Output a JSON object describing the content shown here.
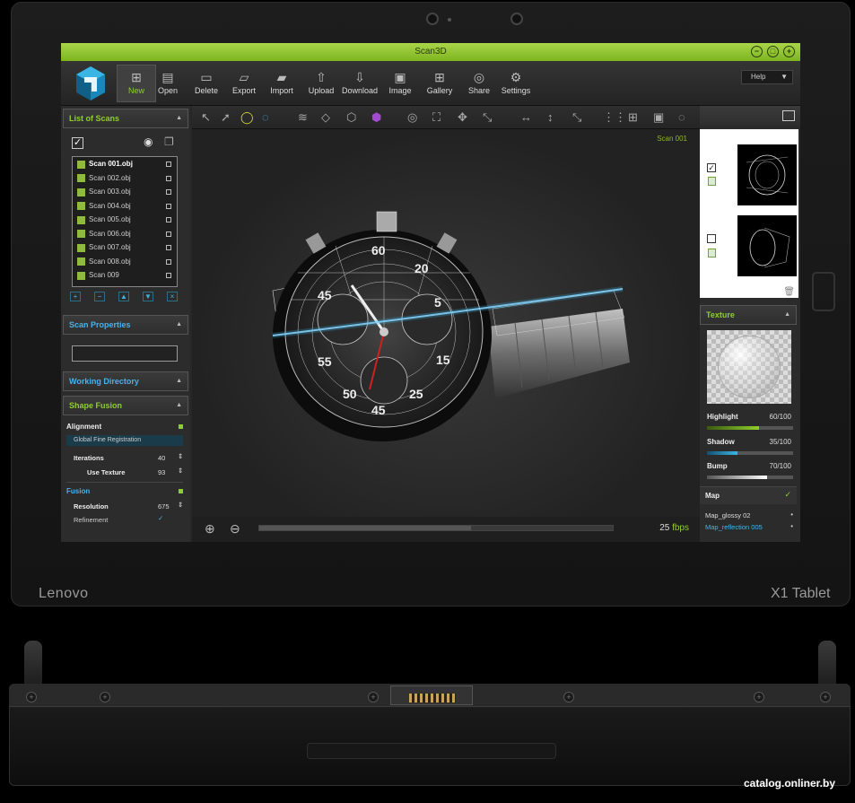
{
  "device": {
    "brand_left": "Lenovo",
    "brand_right": "X1 Tablet",
    "watermark": "catalog.onliner.by"
  },
  "app": {
    "title": "Scan3D",
    "accent": "#8fcf2c",
    "window_controls": [
      "minimize",
      "restore",
      "close"
    ]
  },
  "toolbar": {
    "buttons": [
      {
        "label": "New",
        "icon": "new-file-icon",
        "active": true
      },
      {
        "label": "Open",
        "icon": "open-file-icon"
      },
      {
        "label": "Delete",
        "icon": "delete-file-icon"
      },
      {
        "label": "Export",
        "icon": "folder-icon"
      },
      {
        "label": "Import",
        "icon": "import-folder-icon"
      },
      {
        "label": "Upload",
        "icon": "upload-icon"
      },
      {
        "label": "Download",
        "icon": "download-icon"
      },
      {
        "label": "Image",
        "icon": "image-icon"
      },
      {
        "label": "Gallery",
        "icon": "gallery-grid-icon"
      },
      {
        "label": "Share",
        "icon": "globe-icon"
      },
      {
        "label": "Settings",
        "icon": "gear-icon"
      }
    ],
    "help": "Help"
  },
  "left_panel": {
    "list_header": "List of Scans",
    "scans": [
      "Scan 001.obj",
      "Scan 002.obj",
      "Scan 003.obj",
      "Scan 004.obj",
      "Scan 005.obj",
      "Scan 006.obj",
      "Scan 007.obj",
      "Scan 008.obj",
      "Scan 009"
    ],
    "list_buttons": [
      "+",
      "−",
      "▲",
      "▼",
      "×"
    ],
    "scan_properties": "Scan Properties",
    "working_directory": "Working Directory",
    "shape_fusion": "Shape Fusion",
    "alignment": "Alignment",
    "registration": "Global Fine Registration",
    "iterations_label": "Iterations",
    "iterations_value": "40",
    "use_texture_label": "Use Texture",
    "use_texture_value": "93",
    "fusion": "Fusion",
    "resolution_label": "Resolution",
    "resolution_value": "675",
    "refinement_label": "Refinement"
  },
  "viewport": {
    "scan_label": "Scan 001",
    "fps_value": "25",
    "fps_unit": "fbps",
    "progress": 0.6
  },
  "right_panel": {
    "texture": "Texture",
    "highlight_label": "Highlight",
    "highlight_value": "60/100",
    "highlight": 0.6,
    "shadow_label": "Shadow",
    "shadow_value": "35/100",
    "shadow": 0.35,
    "bump_label": "Bump",
    "bump_value": "70/100",
    "bump": 0.7,
    "map_label": "Map",
    "map_items": [
      "Map_glossy 02",
      "Map_reflection 005"
    ]
  }
}
